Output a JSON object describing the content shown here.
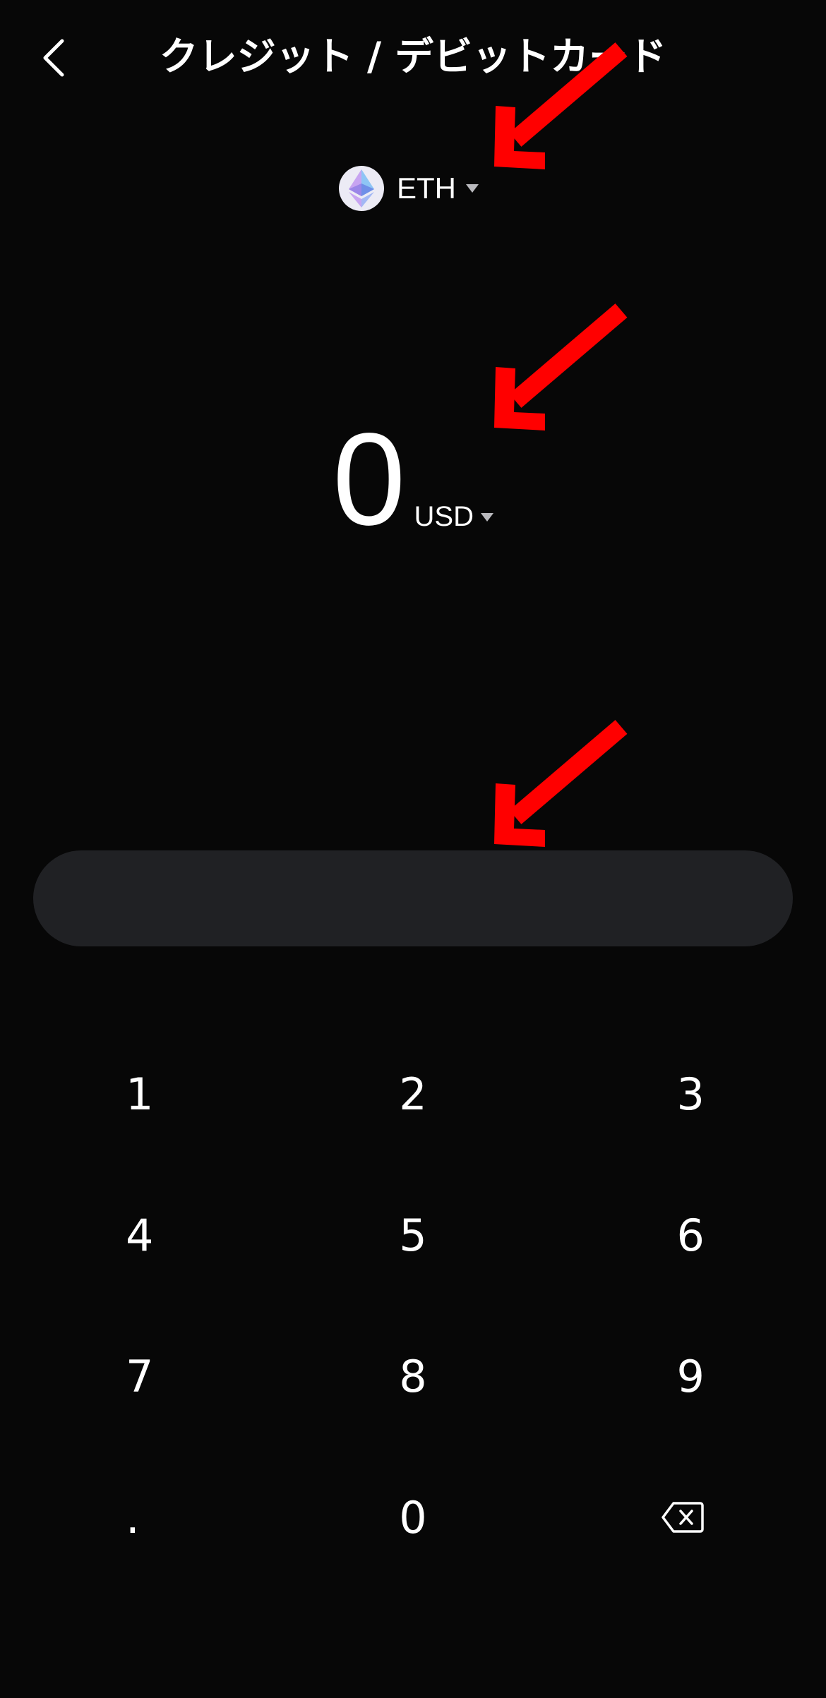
{
  "header": {
    "back_icon": "chevron-left-icon",
    "title": "クレジット / デビットカード"
  },
  "asset": {
    "symbol": "ETH",
    "icon": "ethereum-icon",
    "dropdown_icon": "caret-down-icon"
  },
  "amount": {
    "value": "0",
    "currency": "USD",
    "dropdown_icon": "caret-down-icon"
  },
  "keypad": {
    "keys": [
      "1",
      "2",
      "3",
      "4",
      "5",
      "6",
      "7",
      "8",
      "9",
      ".",
      "0"
    ],
    "backspace_icon": "backspace-icon"
  },
  "colors": {
    "background": "#070707",
    "pill": "#202124",
    "text": "#ffffff",
    "caret": "#b9b9bd",
    "annotation_arrow": "#ff0000"
  }
}
